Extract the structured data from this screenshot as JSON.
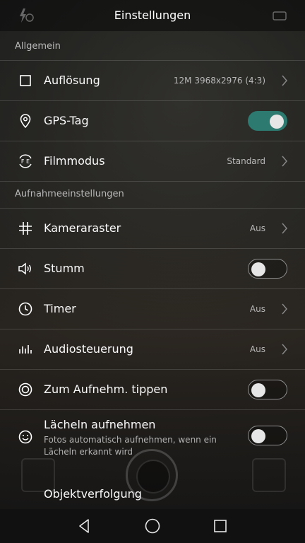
{
  "header": {
    "title": "Einstellungen"
  },
  "sections": {
    "general": "Allgemein",
    "capture": "Aufnahmeeinstellungen"
  },
  "rows": {
    "resolution": {
      "label": "Auflösung",
      "value": "12M 3968x2976 (4:3)"
    },
    "gps": {
      "label": "GPS-Tag",
      "on": true
    },
    "film": {
      "label": "Filmmodus",
      "value": "Standard"
    },
    "grid": {
      "label": "Kameraraster",
      "value": "Aus"
    },
    "mute": {
      "label": "Stumm",
      "on": false
    },
    "timer": {
      "label": "Timer",
      "value": "Aus"
    },
    "audio": {
      "label": "Audiosteuerung",
      "value": "Aus"
    },
    "tap": {
      "label": "Zum Aufnehm. tippen",
      "on": false
    },
    "smile": {
      "label": "Lächeln aufnehmen",
      "sub": "Fotos automatisch aufnehmen, wenn ein Lächeln erkannt wird",
      "on": false
    },
    "tracking": {
      "label": "Objektverfolgung"
    }
  },
  "colors": {
    "toggle_on": "#2d7a71"
  },
  "icons": [
    "flash-icon",
    "crop-square-icon",
    "location-pin-icon",
    "film-mode-icon",
    "grid-icon",
    "speaker-icon",
    "clock-icon",
    "audio-bars-icon",
    "touch-circle-icon",
    "smile-icon",
    "back-icon",
    "home-icon",
    "recents-icon"
  ]
}
